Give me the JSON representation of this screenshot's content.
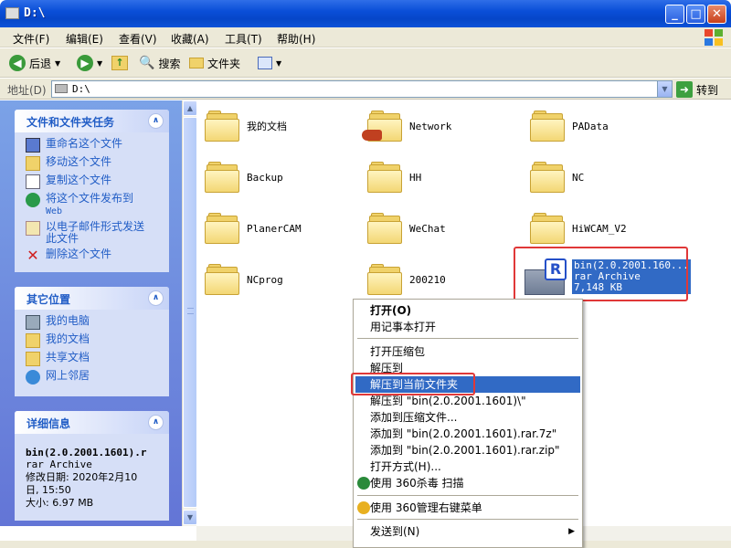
{
  "window": {
    "title": "D:\\",
    "minimize": "_",
    "maximize": "□",
    "close": "✕"
  },
  "menu": [
    "文件(F)",
    "编辑(E)",
    "查看(V)",
    "收藏(A)",
    "工具(T)",
    "帮助(H)"
  ],
  "toolbar": {
    "back": "后退",
    "search": "搜索",
    "folders": "文件夹"
  },
  "address": {
    "label": "地址(D)",
    "value": "D:\\",
    "go": "转到"
  },
  "tasks_panel": {
    "title": "文件和文件夹任务",
    "items": [
      "重命名这个文件",
      "移动这个文件",
      "复制这个文件",
      "将这个文件发布到",
      "Web",
      "以电子邮件形式发送",
      "此文件",
      "删除这个文件"
    ]
  },
  "places_panel": {
    "title": "其它位置",
    "items": [
      "我的电脑",
      "我的文档",
      "共享文档",
      "网上邻居"
    ]
  },
  "details_panel": {
    "title": "详细信息",
    "name": "bin(2.0.2001.1601).r",
    "type": "rar Archive",
    "modified_label": "修改日期: 2020年2月10",
    "modified_time": "日, 15:50",
    "size": "大小: 6.97 MB"
  },
  "files": [
    {
      "name": "我的文档"
    },
    {
      "name": "Network"
    },
    {
      "name": "PAData"
    },
    {
      "name": "Backup"
    },
    {
      "name": "HH"
    },
    {
      "name": "NC"
    },
    {
      "name": "PlanerCAM"
    },
    {
      "name": "WeChat"
    },
    {
      "name": "HiWCAM_V2"
    },
    {
      "name": "NCprog"
    },
    {
      "name": "200210"
    }
  ],
  "selected_file": {
    "name": "bin(2.0.2001.160...",
    "type": "rar Archive",
    "size": "7,148 KB"
  },
  "context_menu": {
    "open": "打开(O)",
    "notepad": "用记事本打开",
    "open_archive": "打开压缩包",
    "extract_to": "解压到",
    "extract_here": "解压到当前文件夹",
    "extract_folder": "解压到 \"bin(2.0.2001.1601)\\\"",
    "add_archive": "添加到压缩文件...",
    "add_7z": "添加到 \"bin(2.0.2001.1601).rar.7z\"",
    "add_zip": "添加到 \"bin(2.0.2001.1601).rar.zip\"",
    "open_with": "打开方式(H)...",
    "scan360": "使用 360杀毒 扫描",
    "menu360": "使用 360管理右键菜单",
    "send_to": "发送到(N)"
  }
}
